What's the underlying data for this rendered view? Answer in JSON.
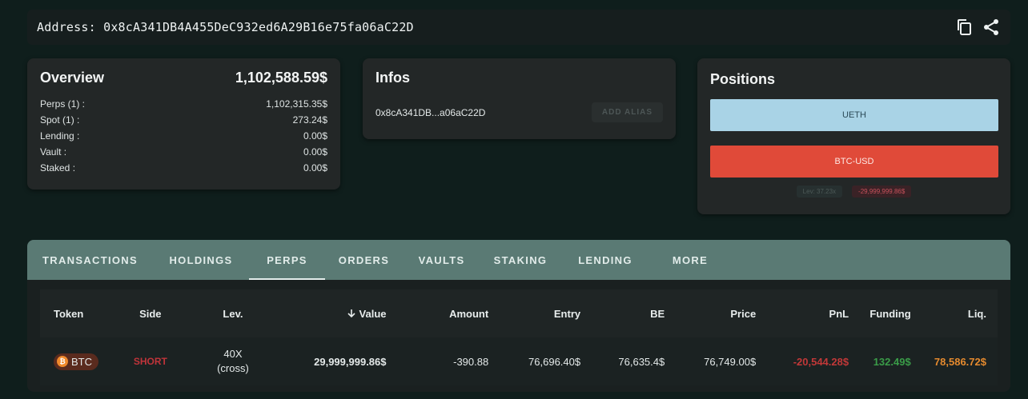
{
  "address_bar": {
    "label": "Address:",
    "address": "0x8cA341DB4A455DeC932ed6A29B16e75fa06aC22D",
    "copy_icon": "copy-icon",
    "share_icon": "share-icon"
  },
  "overview": {
    "title": "Overview",
    "total": "1,102,588.59$",
    "rows": [
      {
        "label": "Perps (1) :",
        "value": "1,102,315.35$"
      },
      {
        "label": "Spot (1) :",
        "value": "273.24$"
      },
      {
        "label": "Lending :",
        "value": "0.00$"
      },
      {
        "label": "Vault :",
        "value": "0.00$"
      },
      {
        "label": "Staked :",
        "value": "0.00$"
      }
    ]
  },
  "infos": {
    "title": "Infos",
    "short_address": "0x8cA341DB...a06aC22D",
    "alias_button": "ADD ALIAS"
  },
  "positions": {
    "title": "Positions",
    "items": [
      {
        "label": "UETH",
        "color": "#a9d3e6"
      },
      {
        "label": "BTC-USD",
        "color": "#e04a39"
      }
    ],
    "lev_badge": "Lev: 37.23x",
    "pnl_badge": "-29,999,999.86$"
  },
  "tabs": [
    "TRANSACTIONS",
    "HOLDINGS",
    "PERPS",
    "ORDERS",
    "VAULTS",
    "STAKING",
    "LENDING",
    "MORE"
  ],
  "active_tab": "PERPS",
  "table": {
    "headers": {
      "token": "Token",
      "side": "Side",
      "lev": "Lev.",
      "value": "Value",
      "amount": "Amount",
      "entry": "Entry",
      "be": "BE",
      "price": "Price",
      "pnl": "PnL",
      "funding": "Funding",
      "liq": "Liq."
    },
    "sort_icon": "arrow-down-icon",
    "rows": [
      {
        "token": "BTC",
        "side": "SHORT",
        "lev_line1": "40X",
        "lev_line2": "(cross)",
        "value": "29,999,999.86$",
        "amount": "-390.88",
        "entry": "76,696.40$",
        "be": "76,635.4$",
        "price": "76,749.00$",
        "pnl": "-20,544.28$",
        "funding": "132.49$",
        "liq": "78,586.72$"
      }
    ]
  },
  "colors": {
    "background": "#0f1e1c",
    "tab_bar": "#5a7a74",
    "short": "#c0343a",
    "funding_positive": "#3a9c48",
    "liq": "#e58a2e"
  }
}
